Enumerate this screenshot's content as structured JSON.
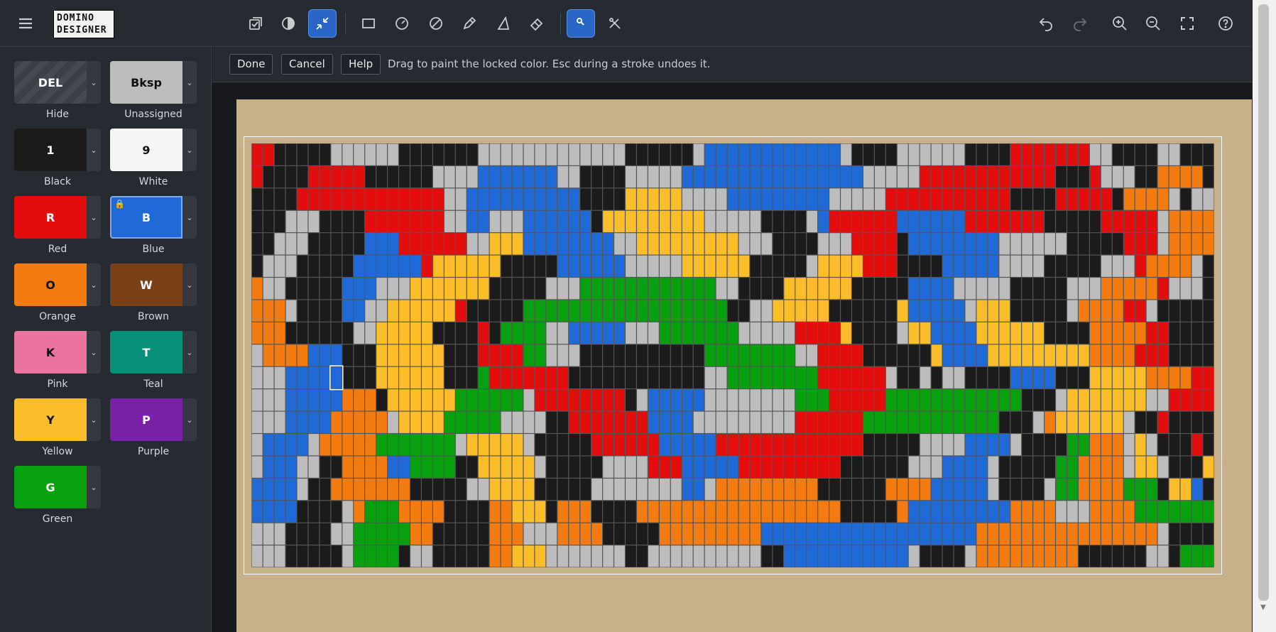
{
  "app": {
    "logo_text": "DOMINO DESIGNER"
  },
  "toolbar": {
    "menu": "menu-icon",
    "left_tools": [
      "select-icon",
      "contrast-icon",
      "shrink-icon",
      "rectangle-icon",
      "circle-icon",
      "no-icon",
      "pencil-icon",
      "triangle-icon",
      "eraser-icon"
    ],
    "mid_tools": [
      "eyedropper-icon",
      "pathfind-icon"
    ],
    "active_tools": [
      "shrink-icon",
      "eyedropper-icon"
    ],
    "right_tools": [
      "undo-icon",
      "redo-icon",
      "zoom-in-icon",
      "zoom-out-icon",
      "fullscreen-icon",
      "help-icon"
    ]
  },
  "subtoolbar": {
    "done": "Done",
    "cancel": "Cancel",
    "help": "Help",
    "hint": "Drag to paint the locked color. Esc during a stroke undoes it."
  },
  "palette": [
    {
      "key": "DEL",
      "label": "Hide",
      "color": "#3b3f46",
      "text_color": "#ffffff",
      "pattern": "hatch"
    },
    {
      "key": "Bksp",
      "label": "Unassigned",
      "color": "#bdbdbd",
      "text_color": "#111111"
    },
    {
      "key": "1",
      "label": "Black",
      "color": "#1b1b1b",
      "text_color": "#ffffff"
    },
    {
      "key": "9",
      "label": "White",
      "color": "#f5f5f5",
      "text_color": "#111111"
    },
    {
      "key": "R",
      "label": "Red",
      "color": "#e30d0d",
      "text_color": "#ffffff"
    },
    {
      "key": "B",
      "label": "Blue",
      "color": "#1f6ad6",
      "text_color": "#ffffff",
      "selected": true,
      "locked": true
    },
    {
      "key": "O",
      "label": "Orange",
      "color": "#f47b0f",
      "text_color": "#111111"
    },
    {
      "key": "W",
      "label": "Brown",
      "color": "#7a4018",
      "text_color": "#ffffff"
    },
    {
      "key": "K",
      "label": "Pink",
      "color": "#ea73a0",
      "text_color": "#111111"
    },
    {
      "key": "T",
      "label": "Teal",
      "color": "#069077",
      "text_color": "#ffffff"
    },
    {
      "key": "Y",
      "label": "Yellow",
      "color": "#fbbe2a",
      "text_color": "#111111"
    },
    {
      "key": "P",
      "label": "Purple",
      "color": "#7a1fa8",
      "text_color": "#ffffff"
    },
    {
      "key": "G",
      "label": "Green",
      "color": "#08a00e",
      "text_color": "#ffffff"
    }
  ],
  "grid": {
    "cols": 85,
    "rows": 19,
    "legend": {
      "K": "#1b1b1b",
      "A": "#bdbdbd",
      "B": "#1f6ad6",
      "R": "#e30d0d",
      "O": "#f47b0f",
      "Y": "#fbbe2a",
      "G": "#08a00e"
    },
    "cursor_cell": [
      7,
      10
    ],
    "cells": [
      "RRKKKKKAAAAAAKKKKKKKAAAAAAAAAAAAAKKKKKKABBBBBBBBBBBBAKKKKAAAAAAKKKKRRRRRRRAAKKKKAAKKKOOOOOO",
      "RKKKKRRRRRKKKKKKAAAABBBBBBBAAKKKKAAAAABBBBBBBBBBBBBBBBAAAAARRRRRRRRRRRRKKKRAAAKKOOOOKAK",
      "KKKKRRRRRRRRRRRRRAABBBBBBBBBBKKKKYYYYYAAAABBBBBBBBBAAAAARRRRRRRRRRRKKKKRRRRRKOOOOAKAA",
      "KKKAAAKKKKRRRRRRRAABBAAABBBBBBKYYYYYYYYYAAAAAKKKKABRRRRRRBBBBBBRRRRRRRKKKKKRRRRRAOOOOAKKK",
      "KKAAAKKKKKBBBRRRRRRAAYYYBBBBBBBBAAYYYYYYYYYAAAKKKKAAARRRRKBBBBBBBBAAAAAAKKKKKRRRAOOOOAAKKK",
      "KAAAKKKKKBBBBBBRYYYYYYKKKKKBBBBBBAAAAAYYYYYYKKKKKAYYYYRRRKKKKBBBBBAAAAKKKKKAAAROOOOAKKK",
      "OAAKKKKKBBBAAAYYYYYYYKKKKKAAAGGGGGGGGGGGGAAKKKKYYYYYYKKKKKBBBBAAAAAKKKKKAAAOOOOORAAA",
      "OOOAKKKKBBAAYYYYYYRKKKKKGGGGGGGGGGGGGGGGGGKKAAYYYYYKKKKKKYBBBBBAYYYKKKKKAOOOORRAKKK",
      "OOOKKKKKKAAYYYYYKKKKRKGGGGAABBBBBAAAGGGGGGGAAAAARRRRYKKKKAYYBBBBYYYYYYKKKKOOOOORRKKK",
      "AOOOOBBBKKKYYYYYYKKKRRRRGGAAAKKKKKKKKKKKGGGGGGGGAARRRRKKKKKKYBBBBYYYYYYYYYOOOORRRKK",
      "AAABBBBBKKKYYYYYYKKKGRRRRRRRKKKKKKKKKKKKAAGGGGGGGGRRRRRRAKKAKAAKKKKBBBBKKKYYYYYOOOORRRRKK",
      "AAABBBBBOOOKYYYYYYGGGGGGARRRRRRRRKABBBBBAAAAAAAAGGGRRRRRGGGGGGGGGGGGKKKAYYYYYYYAARRRR",
      "AAABBBBOOOOOAYYYYGGGGGAAAAKKRRRRRRRBBBBAAAAAAAAARRRRRRGGGGGGGGGGGGKKKAOYYYYYYAKKR",
      "ABBBBAOOOOOGGGGGGGAYYYYYAKKKKKRRRRRRBBBBBRRRRRRRRRRRRRKKKKKAAAABBBBAKKKKGGOOOAYAKKKR",
      "ABBBAAKKOOOOBBGGGGKKYYYYYAKKKKKAAAARRRBBBBBRRRRRRRRRKKKKKKAAABBBBAKKKKKGGOOOOAYYAKKKY",
      "BBBBAKKOOOOOOOKKKKKAAYYYYKKKKKAAAAAAAABBAOOOOOOOOOKKKKKKOOOOBBBBBAKKKKAGGOOOOGGGKYYB",
      "BBBBKKKKAOGGGOOOOKKKKOOYYYKOOOKKKKOOOOOOOOOOOOOOOOOOKKKKKOBBBBBBBBBOOOOAAAOOOOGGGGGGGA",
      "AAAKKKKAAGGGGGOOKKKKKOOOAAAOOOOKKKKKOOOOOOOOOBBBBBBBBBBBBBBBBBBBOOOOOOOOOOOOOOOOAKKKKGGGGG",
      "AAAKKKKKAGGGGKAAKKKKKOOYYYAAAAAAAKKAAAAAAAAAAKKBBBBBBBBBBBAKKKKAOOOOOOOOOKKKKKKAAKGGGG"
    ]
  }
}
